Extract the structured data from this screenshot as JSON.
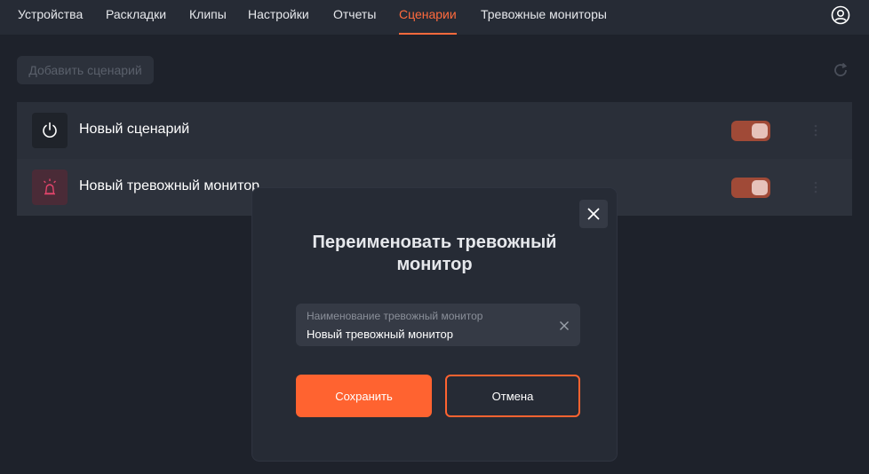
{
  "nav": {
    "tabs": [
      {
        "label": "Устройства"
      },
      {
        "label": "Раскладки"
      },
      {
        "label": "Клипы"
      },
      {
        "label": "Настройки"
      },
      {
        "label": "Отчеты"
      },
      {
        "label": "Сценарии",
        "active": true
      },
      {
        "label": "Тревожные мониторы"
      }
    ],
    "user_icon": "user-circle-icon"
  },
  "toolbar": {
    "add_label": "Добавить сценарий",
    "refresh_icon": "refresh-icon"
  },
  "list": {
    "items": [
      {
        "title": "Новый сценарий",
        "icon": "power-icon",
        "enabled": true
      },
      {
        "title": "Новый тревожный монитор",
        "icon": "alarm-siren-icon",
        "enabled": true
      }
    ]
  },
  "modal": {
    "title": "Переименовать тревожный монитор",
    "field_label": "Наименование тревожный монитор",
    "field_value": "Новый тревожный монитор",
    "save_label": "Сохранить",
    "cancel_label": "Отмена"
  },
  "colors": {
    "accent": "#ff6330",
    "background": "#1e222b",
    "toggle_on": "#a04a37"
  }
}
